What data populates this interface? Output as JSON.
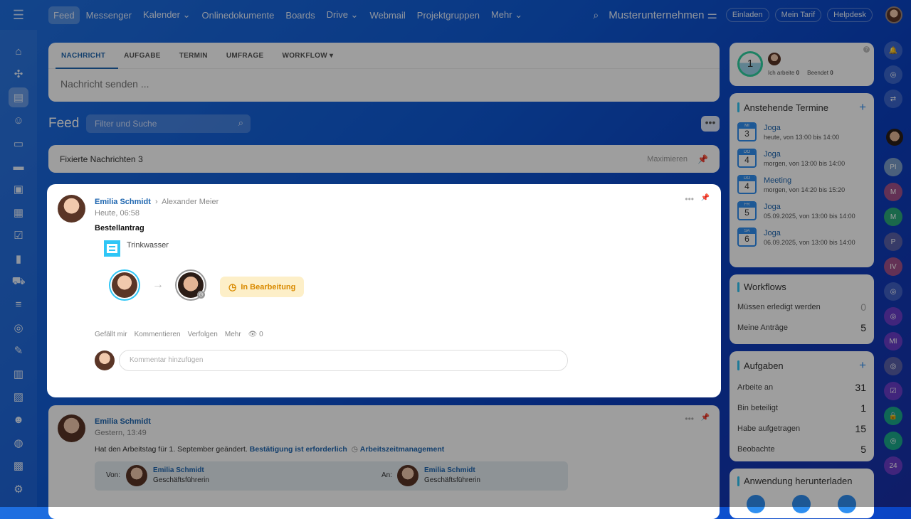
{
  "topbar": {
    "nav": [
      "Feed",
      "Messenger",
      "Kalender ⌄",
      "Onlinedokumente",
      "Boards",
      "Drive ⌄",
      "Webmail",
      "Projektgruppen",
      "Mehr ⌄"
    ],
    "company": "Musterunternehmen",
    "invite": "Einladen",
    "plan": "Mein Tarif",
    "helpdesk": "Helpdesk"
  },
  "sidebar": {
    "icons": [
      "home-icon",
      "puzzle-icon",
      "feed-icon",
      "contacts-icon",
      "document-icon",
      "card-icon",
      "chat-board-icon",
      "calendar-icon",
      "tasks-icon",
      "analytics-icon",
      "cart-icon",
      "funnel-icon",
      "target-icon",
      "sign-icon",
      "warehouse-icon",
      "terminal-icon",
      "robot-icon",
      "shield-icon",
      "timeline-icon",
      "settings-icon"
    ],
    "glyphs": [
      "⌂",
      "✣",
      "▤",
      "☺",
      "▭",
      "▬",
      "▣",
      "▦",
      "☑",
      "▮",
      "⛟",
      "≡",
      "◎",
      "✎",
      "▥",
      "▨",
      "☻",
      "◍",
      "▩",
      "⚙"
    ]
  },
  "composer": {
    "tabs": [
      "NACHRICHT",
      "AUFGABE",
      "TERMIN",
      "UMFRAGE",
      "WORKFLOW ▾"
    ],
    "placeholder": "Nachricht senden ..."
  },
  "feed": {
    "title": "Feed",
    "filter_placeholder": "Filter und Suche",
    "more": "•••"
  },
  "pinned": {
    "label": "Fixierte Nachrichten",
    "count": "3",
    "maximize": "Maximieren"
  },
  "post1": {
    "author": "Emilia Schmidt",
    "recipient": "Alexander Meier",
    "time": "Heute, 06:58",
    "title": "Bestellantrag",
    "item": "Trinkwasser",
    "status": "In Bearbeitung",
    "actions": [
      "Gefällt mir",
      "Kommentieren",
      "Verfolgen",
      "Mehr"
    ],
    "views": "0",
    "comment_placeholder": "Kommentar hinzufügen"
  },
  "post2": {
    "author": "Emilia Schmidt",
    "time": "Gestern, 13:49",
    "text": "Hat den Arbeitstag für 1. September geändert.",
    "link1": "Bestätigung ist erforderlich",
    "link2": "Arbeitszeitmanagement",
    "from_label": "Von:",
    "to_label": "An:",
    "from_name": "Emilia Schmidt",
    "from_role": "Geschäftsführerin",
    "to_name": "Emilia Schmidt",
    "to_role": "Geschäftsführerin"
  },
  "timeman": {
    "count": "1",
    "working_label": "Ich arbeite",
    "working": "0",
    "done_label": "Beendet",
    "done": "0"
  },
  "events": {
    "title": "Anstehende Termine",
    "items": [
      {
        "dow": "MI",
        "day": "3",
        "title": "Joga",
        "time": "heute, von 13:00 bis 14:00"
      },
      {
        "dow": "DO",
        "day": "4",
        "title": "Joga",
        "time": "morgen, von 13:00 bis 14:00"
      },
      {
        "dow": "DO",
        "day": "4",
        "title": "Meeting",
        "time": "morgen, von 14:20 bis 15:20"
      },
      {
        "dow": "FR",
        "day": "5",
        "title": "Joga",
        "time": "05.09.2025, von 13:00 bis 14:00"
      },
      {
        "dow": "SA",
        "day": "6",
        "title": "Joga",
        "time": "06.09.2025, von 13:00 bis 14:00"
      }
    ]
  },
  "workflows": {
    "title": "Workflows",
    "rows": [
      {
        "label": "Müssen erledigt werden",
        "value": "0"
      },
      {
        "label": "Meine Anträge",
        "value": "5"
      }
    ]
  },
  "tasks": {
    "title": "Aufgaben",
    "rows": [
      {
        "label": "Arbeite an",
        "value": "31"
      },
      {
        "label": "Bin beteiligt",
        "value": "1"
      },
      {
        "label": "Habe aufgetragen",
        "value": "15"
      },
      {
        "label": "Beobachte",
        "value": "5"
      }
    ]
  },
  "download": {
    "title": "Anwendung herunterladen"
  },
  "rightstrip": {
    "items": [
      "🔔",
      "◎",
      "⇄",
      "",
      "",
      "PI",
      "M",
      "M",
      "P",
      "IV",
      "◎",
      "◎",
      "MI",
      "◎",
      "☑",
      "🔒",
      "◎",
      "24"
    ]
  }
}
